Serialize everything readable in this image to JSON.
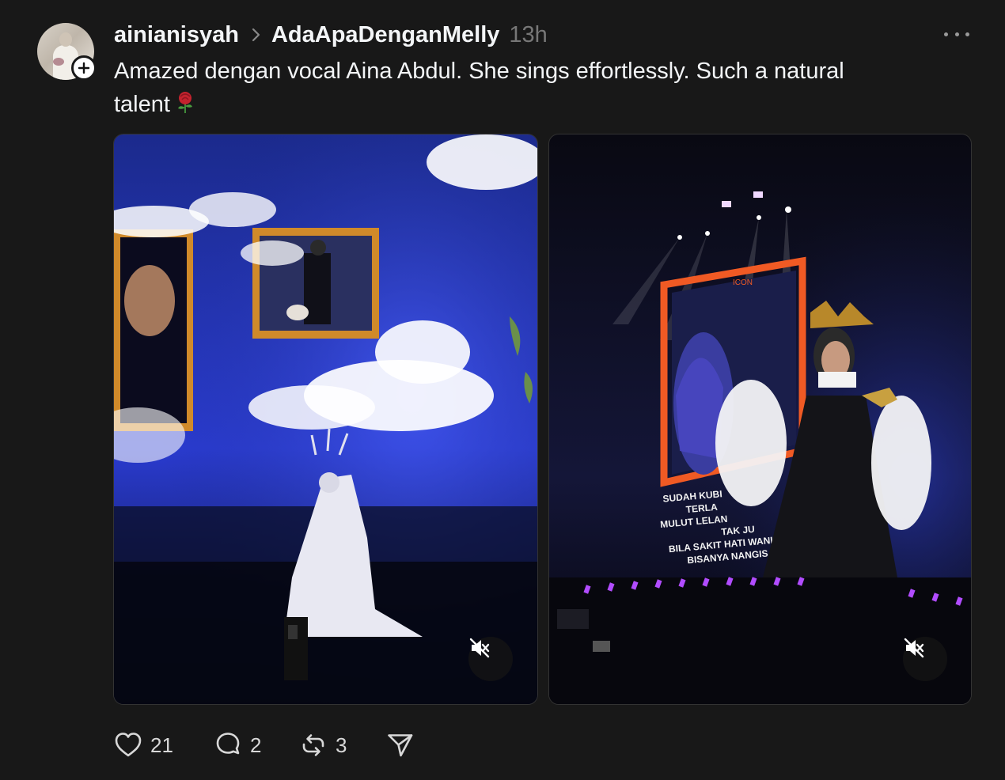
{
  "post": {
    "author": "ainianisyah",
    "community": "AdaApaDenganMelly",
    "time": "13h",
    "text_line1": "Amazed dengan vocal Aina Abdul. She sings effortlessly. Such a natural",
    "text_line2": "talent",
    "emoji": "rose-emoji"
  },
  "media": [
    {
      "type": "video",
      "muted": true,
      "icon": "speaker-muted-icon"
    },
    {
      "type": "video",
      "muted": true,
      "icon": "speaker-muted-icon",
      "frame_title": "ICON",
      "lyrics": [
        "SUDAH KUBI",
        "TERLA",
        "MULUT LELAN",
        "TAK JU",
        "BILA SAKIT HATI WANI",
        "BISANYA NANGIS"
      ]
    }
  ],
  "actions": {
    "like": {
      "icon": "heart-icon",
      "count": "21"
    },
    "reply": {
      "icon": "comment-icon",
      "count": "2"
    },
    "repost": {
      "icon": "repost-icon",
      "count": "3"
    },
    "share": {
      "icon": "send-icon"
    }
  },
  "colors": {
    "background": "#181818",
    "text": "#f3f5f7",
    "muted": "#777777"
  }
}
